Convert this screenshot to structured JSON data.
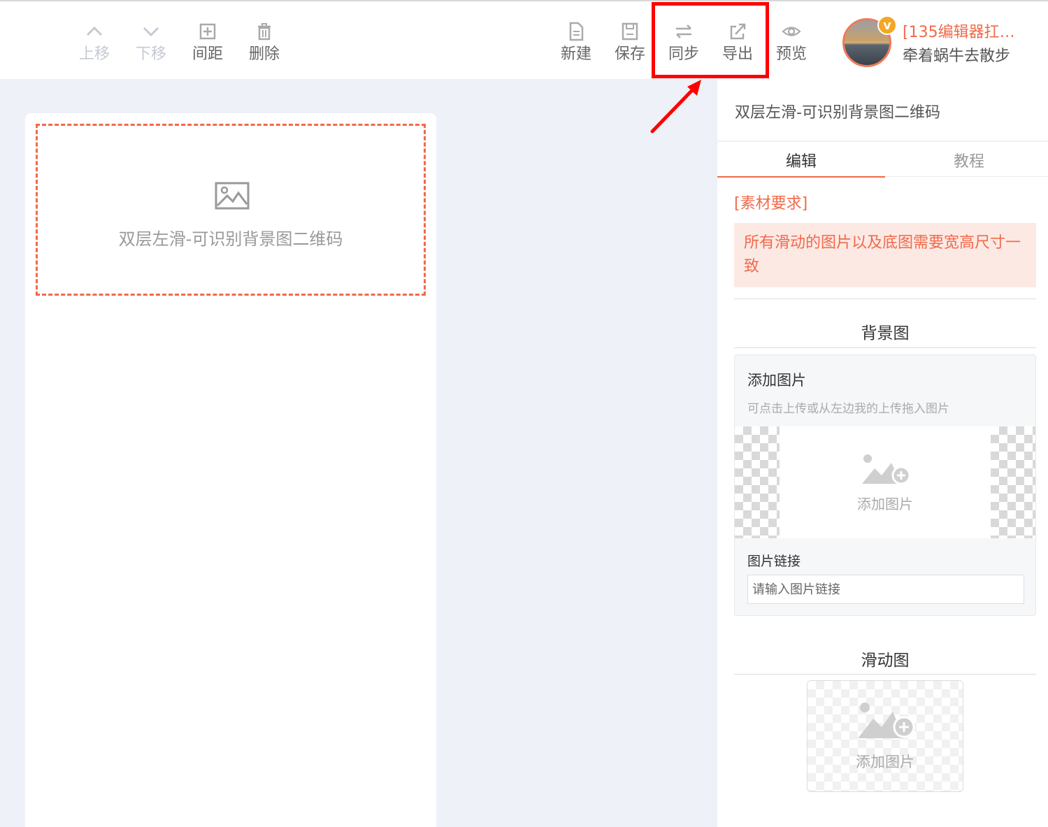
{
  "toolbar": {
    "left_tools": [
      {
        "label": "上移",
        "icon": "chevron-up-icon",
        "disabled": true
      },
      {
        "label": "下移",
        "icon": "chevron-down-icon",
        "disabled": true
      },
      {
        "label": "间距",
        "icon": "spacing-icon",
        "disabled": false
      },
      {
        "label": "删除",
        "icon": "trash-icon",
        "disabled": false
      }
    ],
    "right_tools": [
      {
        "label": "新建",
        "icon": "new-file-icon"
      },
      {
        "label": "保存",
        "icon": "save-icon"
      },
      {
        "label": "同步",
        "icon": "sync-icon"
      },
      {
        "label": "导出",
        "icon": "export-icon"
      },
      {
        "label": "预览",
        "icon": "eye-icon"
      }
    ]
  },
  "user": {
    "badge": "v",
    "tag": "[135编辑器扛…",
    "name": "牵着蜗牛去散步"
  },
  "canvas": {
    "placeholder_text": "双层左滑-可识别背景图二维码"
  },
  "panel": {
    "title": "双层左滑-可识别背景图二维码",
    "tabs": [
      "编辑",
      "教程"
    ],
    "requirement_label": "[素材要求]",
    "requirement_text": "所有滑动的图片以及底图需要宽高尺寸一致",
    "background_section": {
      "title": "背景图",
      "card_title": "添加图片",
      "hint": "可点击上传或从左边我的上传拖入图片",
      "add_label": "添加图片",
      "link_label": "图片链接",
      "link_placeholder": "请输入图片链接"
    },
    "slide_section": {
      "title": "滑动图",
      "add_label": "添加图片"
    }
  },
  "colors": {
    "accent": "#f06a4a",
    "highlight": "#ff0000",
    "canvas_bg": "#eef1f7"
  }
}
